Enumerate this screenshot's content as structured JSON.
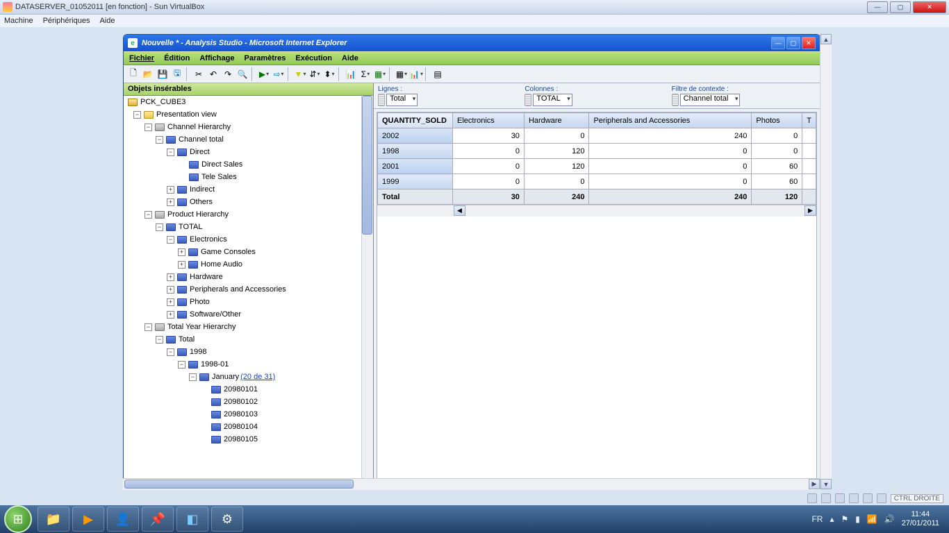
{
  "vbox": {
    "title": "DATASERVER_01052011 [en fonction] - Sun VirtualBox",
    "menu": {
      "machine": "Machine",
      "peripherals": "Périphériques",
      "help": "Aide"
    },
    "status_hostkey": "CTRL DROITE"
  },
  "ie": {
    "title": "Nouvelle * - Analysis Studio - Microsoft Internet Explorer"
  },
  "as": {
    "menu": {
      "file": "Fichier",
      "edit": "Édition",
      "view": "Affichage",
      "params": "Paramètres",
      "exec": "Exécution",
      "help": "Aide"
    },
    "insertable_title": "Objets insérables",
    "tree": {
      "root": "PCK_CUBE3",
      "presentation": "Presentation view",
      "channel_hier": "Channel Hierarchy",
      "channel_total": "Channel total",
      "direct": "Direct",
      "direct_sales": "Direct Sales",
      "tele_sales": "Tele Sales",
      "indirect": "Indirect",
      "others": "Others",
      "product_hier": "Product Hierarchy",
      "total": "TOTAL",
      "electronics": "Electronics",
      "game_consoles": "Game Consoles",
      "home_audio": "Home Audio",
      "hardware": "Hardware",
      "periph": "Peripherals and Accessories",
      "photo": "Photo",
      "software": "Software/Other",
      "year_hier": "Total Year Hierarchy",
      "year_total": "Total",
      "y1998": "1998",
      "y199801": "1998-01",
      "january": "January",
      "january_more": "(20 de 31)",
      "d1": "20980101",
      "d2": "20980102",
      "d3": "20980103",
      "d4": "20980104",
      "d5": "20980105"
    },
    "config": {
      "rows_label": "Lignes :",
      "rows_value": "Total",
      "cols_label": "Colonnes :",
      "cols_value": "TOTAL",
      "ctx_label": "Filtre de contexte :",
      "ctx_value": "Channel total"
    },
    "grid": {
      "corner": "QUANTITY_SOLD",
      "cols": [
        "Electronics",
        "Hardware",
        "Peripherals and Accessories",
        "Photos",
        "T"
      ],
      "rows": [
        {
          "label": "2002",
          "vals": [
            "30",
            "0",
            "240",
            "0"
          ]
        },
        {
          "label": "1998",
          "vals": [
            "0",
            "120",
            "0",
            "0"
          ]
        },
        {
          "label": "2001",
          "vals": [
            "0",
            "120",
            "0",
            "60"
          ]
        },
        {
          "label": "1999",
          "vals": [
            "0",
            "0",
            "0",
            "60"
          ]
        }
      ],
      "total_label": "Total",
      "total_vals": [
        "30",
        "240",
        "240",
        "120"
      ]
    }
  },
  "taskbar": {
    "lang": "FR",
    "time": "11:44",
    "date": "27/01/2011"
  }
}
